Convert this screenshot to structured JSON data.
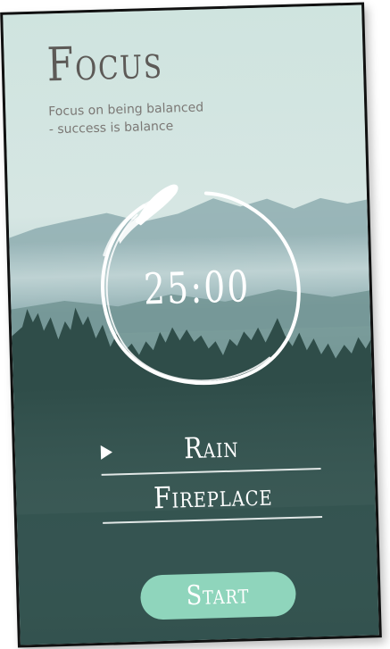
{
  "app": {
    "title": "Focus",
    "subtitle_line1": "Focus on being balanced",
    "subtitle_line2": "- success is balance"
  },
  "timer": {
    "display": "25:00"
  },
  "sounds": [
    {
      "label": "Rain",
      "selected": true
    },
    {
      "label": "Fireplace",
      "selected": false
    }
  ],
  "actions": {
    "start_label": "Start"
  },
  "colors": {
    "accent": "#8fd5bc",
    "title_text": "#5d5a57",
    "subtitle_text": "#7b7875",
    "forest_dark": "#2c4a47"
  },
  "icons": {
    "play": "play-icon",
    "timer_ring": "brush-circle-icon"
  }
}
